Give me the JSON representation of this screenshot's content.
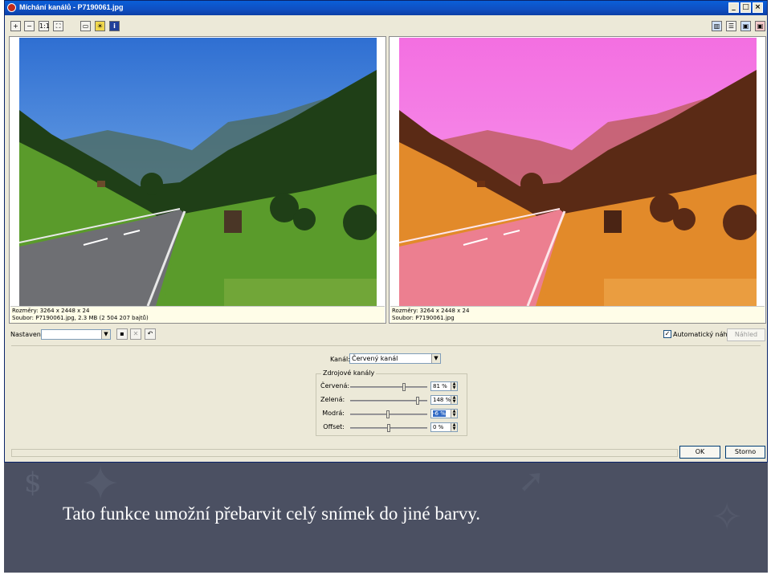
{
  "window": {
    "title": "Míchání kanálů - P7190061.jpg",
    "controls": {
      "minimize": "_",
      "maximize": "□",
      "close": "×"
    }
  },
  "toolbar": {
    "left_icons": [
      "zoom-in-icon",
      "zoom-out-icon",
      "zoom-actual-icon",
      "zoom-fit-icon",
      "image-icon",
      "sun-icon",
      "info-icon"
    ],
    "actual_size_label": "1:1",
    "info_label": "i",
    "right_icons": [
      "layout-side-by-side-icon",
      "layout-stacked-icon",
      "layout-single-icon",
      "layout-original-icon"
    ]
  },
  "preview": {
    "left": {
      "size_line": "Rozměry: 3264 x 2448 x 24",
      "file_line": "Soubor: P7190061.jpg, 2.3 MB (2 504 207 bajtů)",
      "palette": {
        "sky_top": "#2f6fd2",
        "sky_bottom": "#8fc0ef",
        "mountain": "#4e6d68",
        "grass": "#5a9b2b",
        "forest": "#1f3f17",
        "road": "#6e6f73"
      }
    },
    "right": {
      "size_line": "Rozměry: 3264 x 2448 x 24",
      "file_line": "Soubor: P7190061.jpg",
      "palette": {
        "sky_top": "#f36fe1",
        "sky_bottom": "#f9a3ef",
        "mountain": "#c3606c",
        "grass": "#e28a2a",
        "forest": "#5a2a15",
        "road": "#ec7f90"
      }
    }
  },
  "settings": {
    "label": "Nastavení:",
    "value": "",
    "auto_preview_label": "Automatický náhled",
    "auto_preview_checked": true,
    "preview_button": "Náhled"
  },
  "channel": {
    "label": "Kanál:",
    "value": "Červený kanál"
  },
  "sources": {
    "title": "Zdrojové kanály",
    "rows": [
      {
        "label": "Červená:",
        "value": "81 %",
        "level": 0.81
      },
      {
        "label": "Zelená:",
        "value": "148 %",
        "level": 1.48
      },
      {
        "label": "Modrá:",
        "value": "-6 %",
        "level": -0.06,
        "selected": true
      },
      {
        "label": "Offset:",
        "value": "0 %",
        "level": 0.0
      }
    ]
  },
  "buttons": {
    "ok": "OK",
    "cancel": "Storno"
  },
  "slide": {
    "caption": "Tato funkce umožní přebarvit celý snímek do jiné barvy.",
    "background": "#4b5062"
  }
}
